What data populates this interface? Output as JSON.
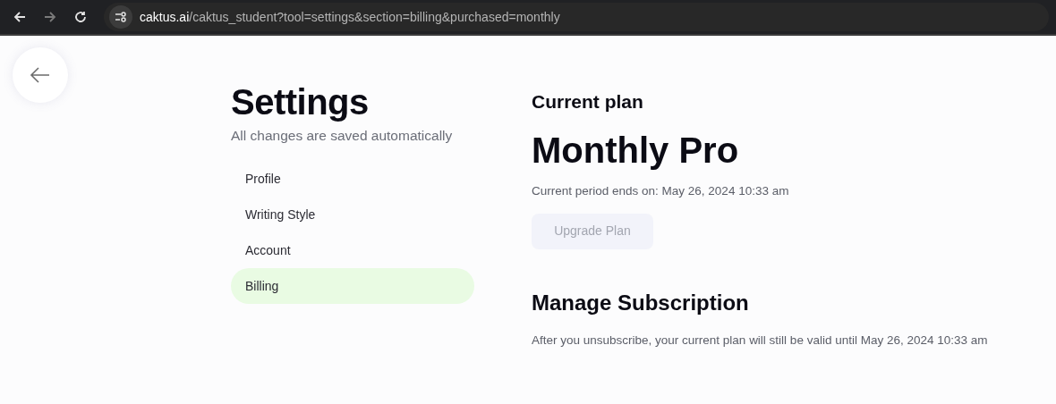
{
  "browser": {
    "address_host": "caktus.ai",
    "address_path": "/caktus_student?tool=settings&section=billing&purchased=monthly",
    "forward_disabled": true
  },
  "settings": {
    "title": "Settings",
    "subtitle": "All changes are saved automatically",
    "nav": [
      {
        "label": "Profile",
        "selected": false
      },
      {
        "label": "Writing Style",
        "selected": false
      },
      {
        "label": "Account",
        "selected": false
      },
      {
        "label": "Billing",
        "selected": true
      }
    ]
  },
  "billing": {
    "heading": "Current plan",
    "plan_name": "Monthly Pro",
    "period_text": "Current period ends on: May 26, 2024 10:33 am",
    "upgrade_button": {
      "label": "Upgrade Plan",
      "disabled": true
    },
    "manage_heading": "Manage Subscription",
    "manage_text": "After you unsubscribe, your current plan will still be valid until May 26, 2024 10:33 am"
  }
}
